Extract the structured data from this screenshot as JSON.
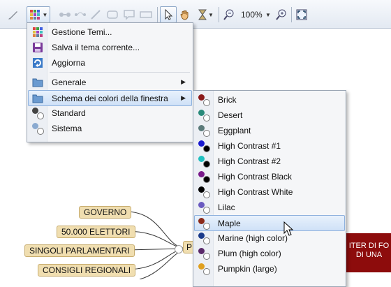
{
  "toolbar": {
    "zoom_value": "100%"
  },
  "theme_menu": {
    "items": [
      {
        "label": "Gestione Temi..."
      },
      {
        "label": "Salva il tema corrente..."
      },
      {
        "label": "Aggiorna"
      },
      {
        "label": "Generale"
      },
      {
        "label": "Schema dei colori della finestra"
      },
      {
        "label": "Standard"
      },
      {
        "label": "Sistema"
      }
    ]
  },
  "color_scheme_menu": {
    "items": [
      {
        "label": "Brick",
        "color_a": "#8b1a1a",
        "color_b": "#ffffff"
      },
      {
        "label": "Desert",
        "color_a": "#2a8a7a",
        "color_b": "#ffffff"
      },
      {
        "label": "Eggplant",
        "color_a": "#5a7a7a",
        "color_b": "#ffffff"
      },
      {
        "label": "High Contrast #1",
        "color_a": "#1a1ad0",
        "color_b": "#000000"
      },
      {
        "label": "High Contrast #2",
        "color_a": "#20c0c0",
        "color_b": "#000000"
      },
      {
        "label": "High Contrast Black",
        "color_a": "#7a1a8a",
        "color_b": "#000000"
      },
      {
        "label": "High Contrast White",
        "color_a": "#000000",
        "color_b": "#ffffff"
      },
      {
        "label": "Lilac",
        "color_a": "#6a5ac0",
        "color_b": "#ffffff"
      },
      {
        "label": "Maple",
        "color_a": "#8b2a1a",
        "color_b": "#ffffff"
      },
      {
        "label": "Marine (high color)",
        "color_a": "#1a3a8a",
        "color_b": "#ffffff"
      },
      {
        "label": "Plum (high color)",
        "color_a": "#5a2a6a",
        "color_b": "#ffffff"
      },
      {
        "label": "Pumpkin (large)",
        "color_a": "#e0a020",
        "color_b": "#ffffff"
      }
    ]
  },
  "mindmap": {
    "nodes": [
      "GOVERNO",
      "50.000 ELETTORI",
      "SINGOLI PARLAMENTARI",
      "CONSIGLI REGIONALI"
    ],
    "center_fragment": "P",
    "red_box_line1": "ITER DI FO",
    "red_box_line2": "DI UNA"
  }
}
